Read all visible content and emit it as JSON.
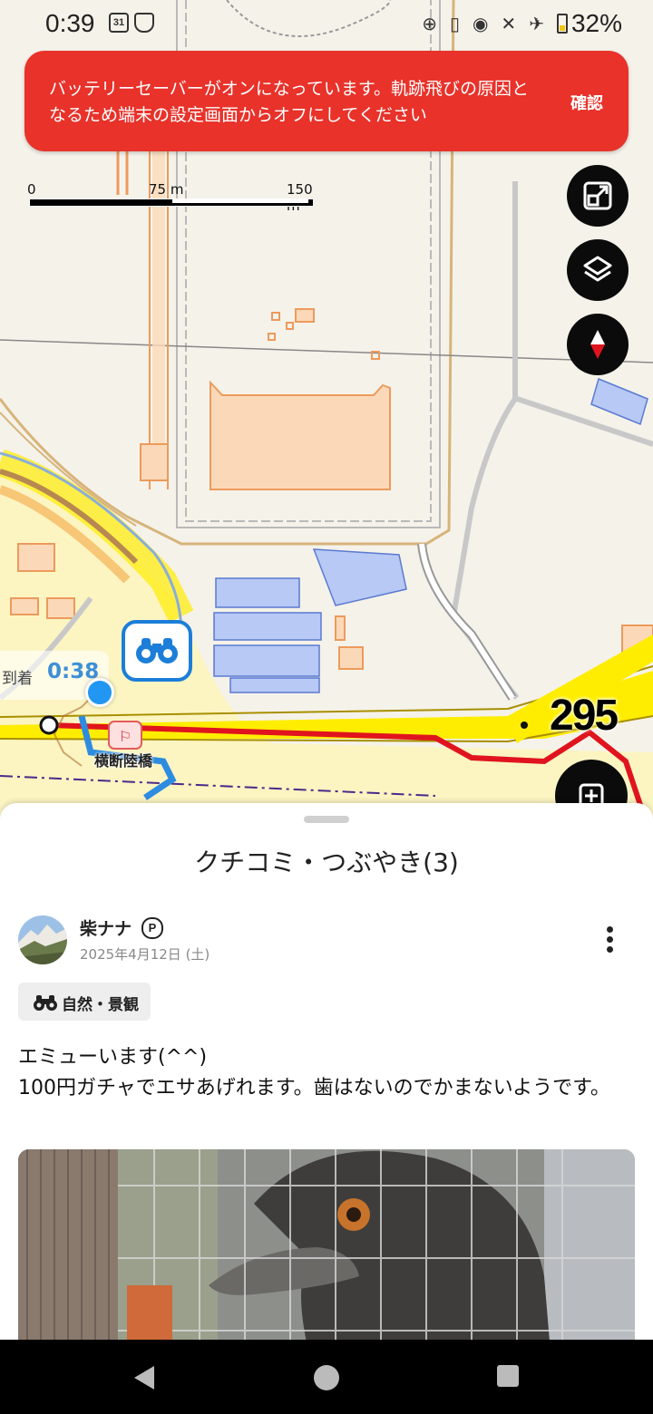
{
  "status_bar": {
    "time": "0:39",
    "calendar_day": "31",
    "battery": "32%",
    "icons": [
      "calendar-icon",
      "shield-icon",
      "target-icon",
      "no-sim-icon",
      "location-icon",
      "mute-icon",
      "airplane-icon",
      "battery-icon"
    ]
  },
  "banner": {
    "message": "バッテリーセーバーがオンになっています。軌跡飛びの原因となるため端末の設定画面からオフにしてください",
    "confirm_label": "確認",
    "color": "#e8322a"
  },
  "map": {
    "scale": {
      "labels": [
        "0",
        "75 m",
        "150 m"
      ]
    },
    "arrival_label": "到着",
    "arrival_time": "0:38",
    "bridge_label": "横断陸橋",
    "road_number": "295",
    "controls": [
      "fit-screen-icon",
      "layers-icon",
      "compass-icon",
      "add-icon"
    ],
    "colors": {
      "road_yellow": "#ffed00",
      "route_red": "#e0141e",
      "track_blue": "#2e8ce0",
      "building": "#fbd9b8",
      "building_stroke": "#ed9a5c",
      "water_blue": "#b7c9f4"
    }
  },
  "sheet": {
    "title": "クチコミ・つぶやき(3)",
    "post": {
      "user_name": "柴ナナ",
      "premium_badge": "P",
      "date": "2025年4月12日 (土)",
      "tag_label": "自然・景観",
      "text_line1": "エミューいます(^^)",
      "text_line2": "100円ガチャでエサあげれます。歯はないのでかまないようです。"
    }
  },
  "nav_bar": {
    "icons": [
      "back-icon",
      "home-icon",
      "recents-icon"
    ]
  }
}
